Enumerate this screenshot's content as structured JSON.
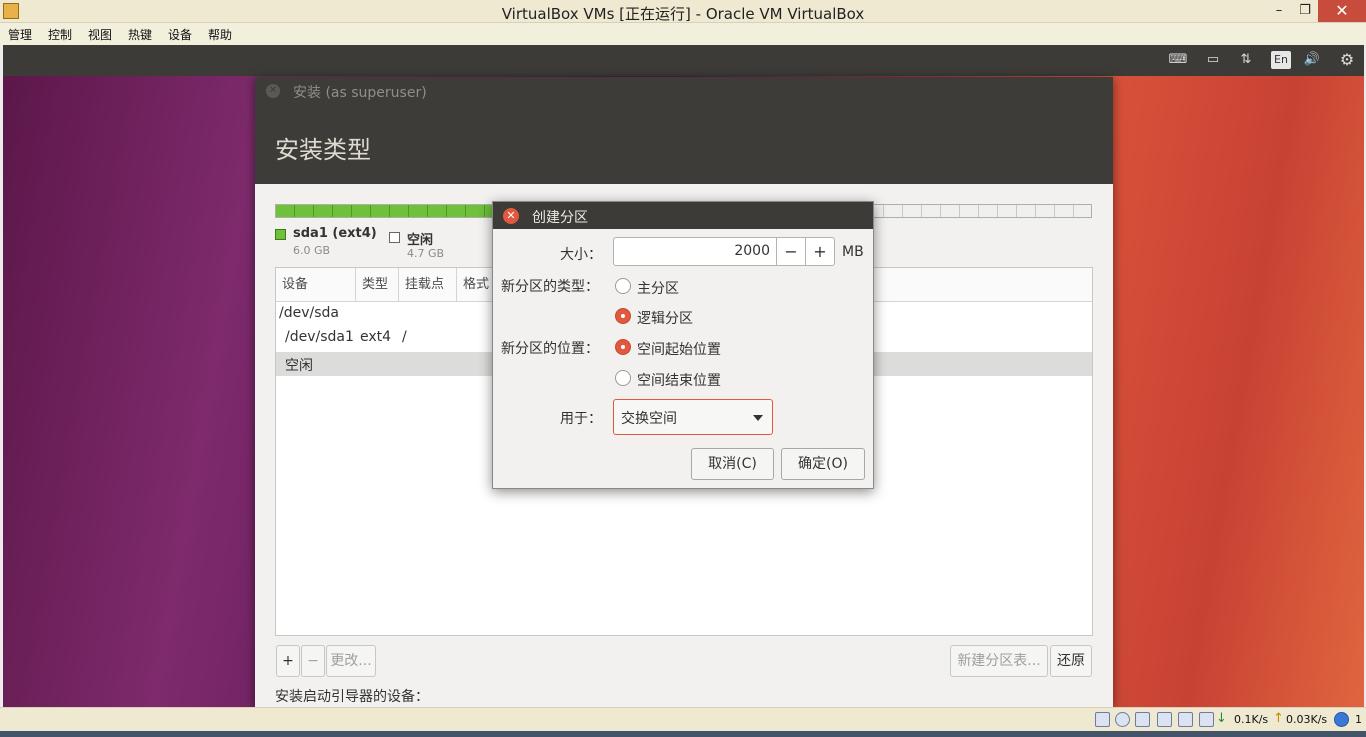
{
  "host": {
    "title": "VirtualBox VMs [正在运行] - Oracle VM VirtualBox",
    "controls": {
      "minimize": "–",
      "maximize": "❐",
      "close": "✕"
    },
    "menu": [
      "管理",
      "控制",
      "视图",
      "热键",
      "设备",
      "帮助"
    ],
    "status": {
      "down_rate": "0.1K/s",
      "up_rate": "0.03K/s",
      "trailing": "1"
    }
  },
  "guest_panel": {
    "icons": [
      "keyboard-icon",
      "battery-icon",
      "network-icon",
      "keyboard-layout-indicator",
      "volume-icon",
      "settings-gear-icon"
    ],
    "input_method": "En"
  },
  "installer": {
    "window_title": "安装 (as superuser)",
    "heading": "安装类型",
    "disk_used_fraction": 0.56,
    "legend": [
      {
        "name": "sda1 (ext4)",
        "size": "6.0 GB",
        "color": "#6fc03a"
      },
      {
        "name": "空闲",
        "size": "4.7 GB",
        "color": "#ffffff"
      }
    ],
    "table": {
      "columns": [
        "设备",
        "类型",
        "挂载点",
        "格式"
      ],
      "rows": [
        {
          "device": "/dev/sda",
          "type": "",
          "mount": ""
        },
        {
          "device": "/dev/sda1",
          "type": "ext4",
          "mount": "/"
        },
        {
          "device": "空闲",
          "type": "",
          "mount": ""
        }
      ]
    },
    "buttons": {
      "add": "+",
      "remove": "−",
      "change": "更改...",
      "new_table": "新建分区表...",
      "revert": "还原"
    },
    "boot_device_label": "安装启动引导器的设备："
  },
  "dialog": {
    "title": "创建分区",
    "size_label": "大小：",
    "size_value": "2000",
    "size_minus": "−",
    "size_plus": "+",
    "size_unit": "MB",
    "type_label": "新分区的类型：",
    "type_options": [
      "主分区",
      "逻辑分区"
    ],
    "type_selected": 1,
    "location_label": "新分区的位置：",
    "location_options": [
      "空间起始位置",
      "空间结束位置"
    ],
    "location_selected": 0,
    "use_as_label": "用于：",
    "use_as_value": "交换空间",
    "cancel": "取消(C)",
    "ok": "确定(O)"
  }
}
